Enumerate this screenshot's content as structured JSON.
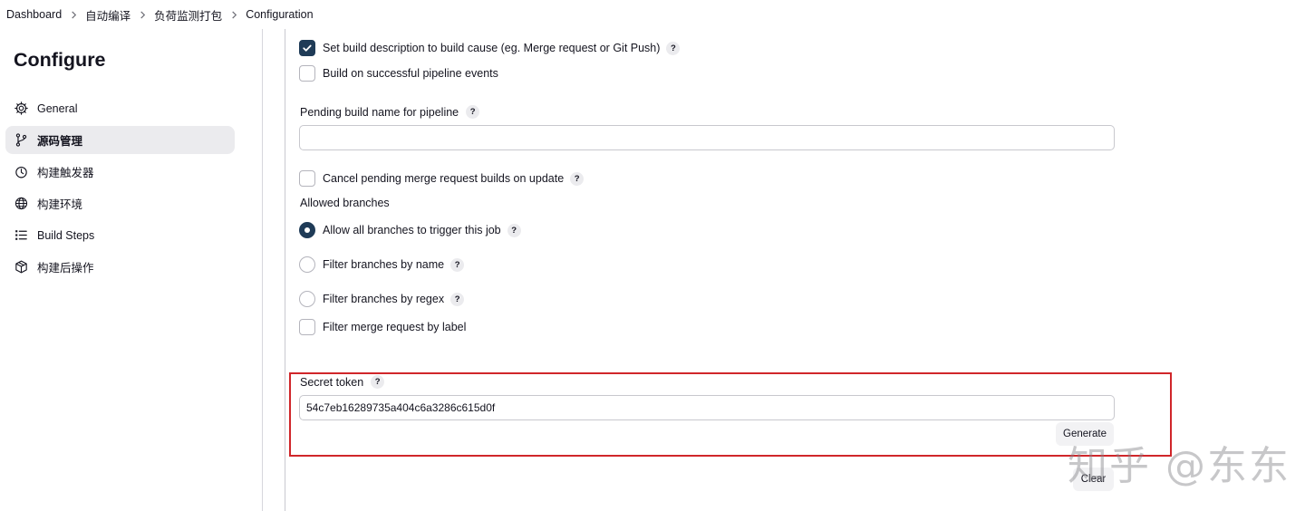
{
  "breadcrumb": {
    "items": [
      "Dashboard",
      "自动编译",
      "负荷监测打包",
      "Configuration"
    ]
  },
  "sidebar": {
    "title": "Configure",
    "items": [
      {
        "label": "General",
        "icon": "gear-icon"
      },
      {
        "label": "源码管理",
        "icon": "source-branch-icon",
        "active": true
      },
      {
        "label": "构建触发器",
        "icon": "timer-icon"
      },
      {
        "label": "构建环境",
        "icon": "globe-icon"
      },
      {
        "label": "Build Steps",
        "icon": "list-icon"
      },
      {
        "label": "构建后操作",
        "icon": "package-icon"
      }
    ]
  },
  "form": {
    "set_build_description": {
      "label": "Set build description to build cause (eg. Merge request or Git Push)",
      "checked": true
    },
    "build_on_pipeline": {
      "label": "Build on successful pipeline events",
      "checked": false
    },
    "pending_build_name": {
      "label": "Pending build name for pipeline",
      "value": ""
    },
    "cancel_pending": {
      "label": "Cancel pending merge request builds on update",
      "checked": false
    },
    "allowed_branches": {
      "label": "Allowed branches",
      "options": [
        {
          "label": "Allow all branches to trigger this job",
          "selected": true
        },
        {
          "label": "Filter branches by name",
          "selected": false
        },
        {
          "label": "Filter branches by regex",
          "selected": false
        }
      ]
    },
    "filter_merge_label": {
      "label": "Filter merge request by label",
      "checked": false
    },
    "secret_token": {
      "label": "Secret token",
      "value": "54c7eb16289735a404c6a3286c615d0f"
    },
    "generate_label": "Generate",
    "clear_label": "Clear",
    "help_glyph": "?"
  },
  "watermark": "知乎 @东东",
  "colors": {
    "accent": "#1f3b57",
    "highlight": "#d0262a",
    "active_bg": "#ebebee"
  }
}
